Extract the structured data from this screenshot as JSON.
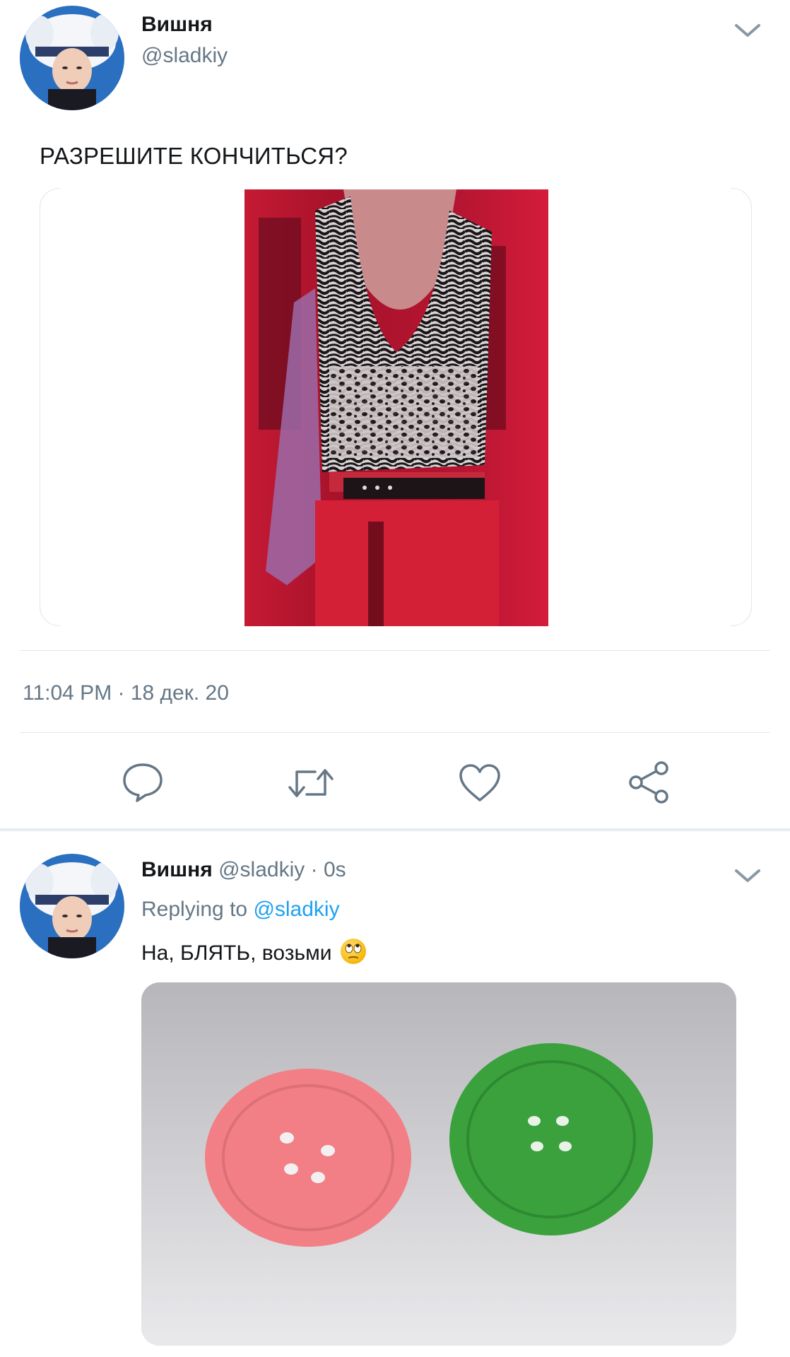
{
  "main_tweet": {
    "author_name": "Вишня",
    "author_handle": "@sladkiy",
    "text": "РАЗРЕШИТЕ КОНЧИТЬСЯ?",
    "timestamp": "11:04 PM · 18 дек. 20",
    "avatar_icon": "avatar-photo",
    "media_description_icon": "photo-red-outfit"
  },
  "actions": [
    {
      "name": "reply",
      "icon": "speech-bubble-icon"
    },
    {
      "name": "retweet",
      "icon": "retweet-icon"
    },
    {
      "name": "like",
      "icon": "heart-icon"
    },
    {
      "name": "share",
      "icon": "share-icon"
    }
  ],
  "reply_tweet": {
    "author_name": "Вишня",
    "author_handle": "@sladkiy",
    "separator": "·",
    "age": "0s",
    "replying_prefix": "Replying to",
    "replying_handle": "@sladkiy",
    "text": "На, БЛЯТЬ, возьми",
    "emoji": "eye-roll-emoji"
  },
  "colors": {
    "text_primary": "#14171a",
    "text_secondary": "#657786",
    "link": "#1da1f2",
    "divider": "#e1e8ed"
  }
}
